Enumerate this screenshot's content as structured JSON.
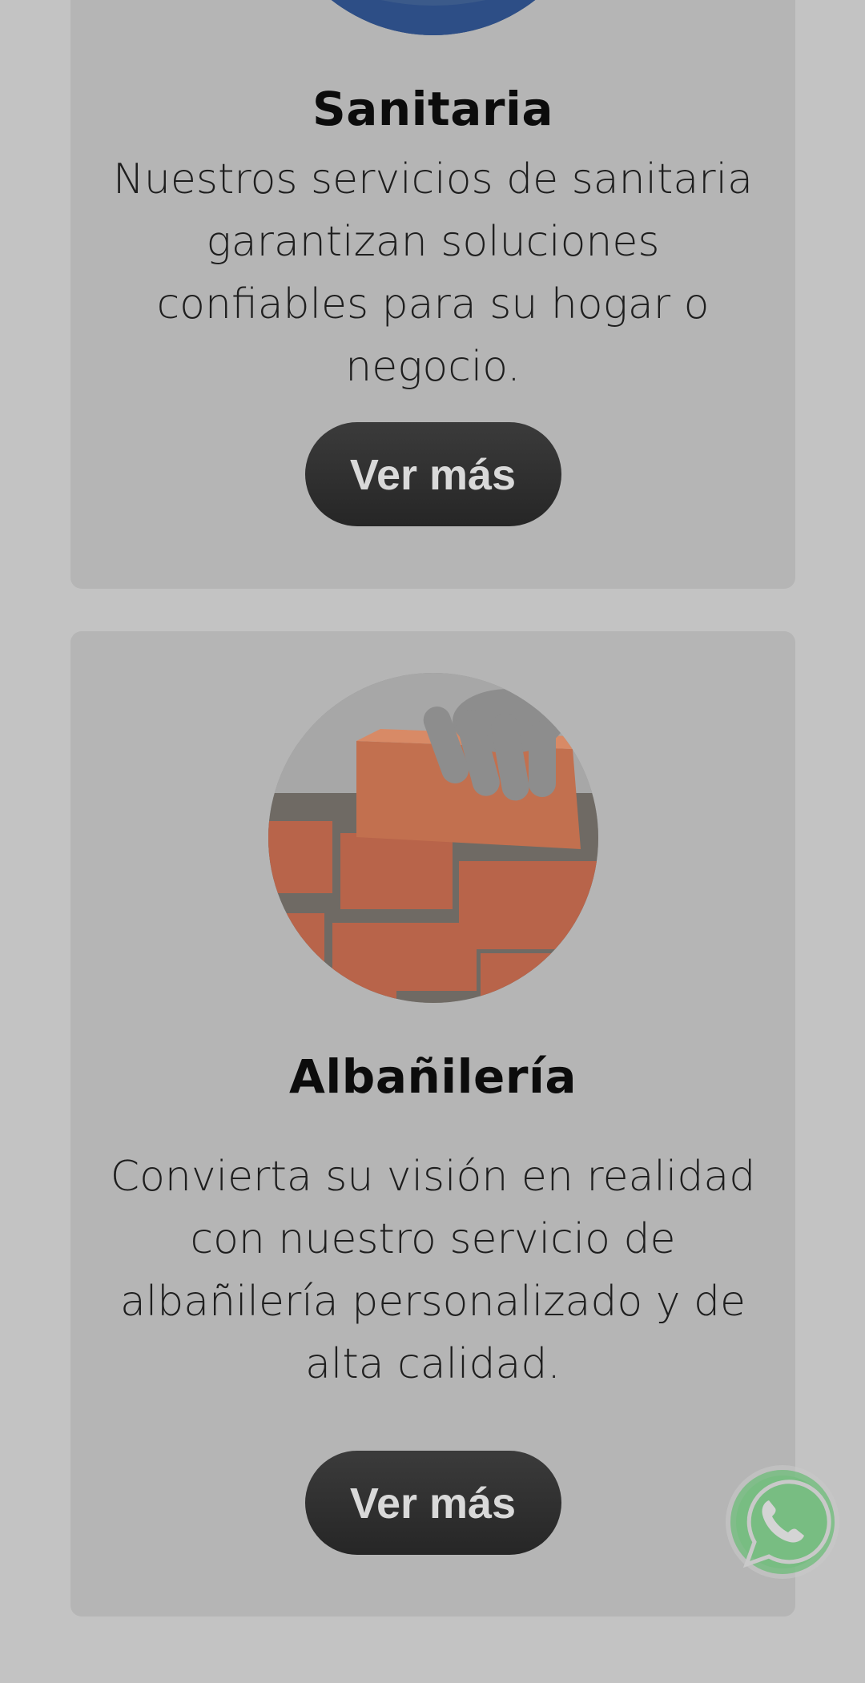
{
  "cards": [
    {
      "title": "Sanitaria",
      "description": "Nuestros servicios de sanitaria garantizan soluciones confiables para su hogar o negocio.",
      "button_label": "Ver más",
      "image_icon": "plumbing-photo"
    },
    {
      "title": "Albañilería",
      "description": "Convierta su visión en realidad con nuestro servicio de albañilería personalizado y de alta calidad.",
      "button_label": "Ver más",
      "image_icon": "brick-wall-photo"
    }
  ],
  "floating": {
    "whatsapp_icon": "whatsapp-icon"
  },
  "colors": {
    "background": "#c3c3c3",
    "card": "#b5b5b5",
    "button": "#2f2f2f",
    "whatsapp": "#7fbf86"
  }
}
